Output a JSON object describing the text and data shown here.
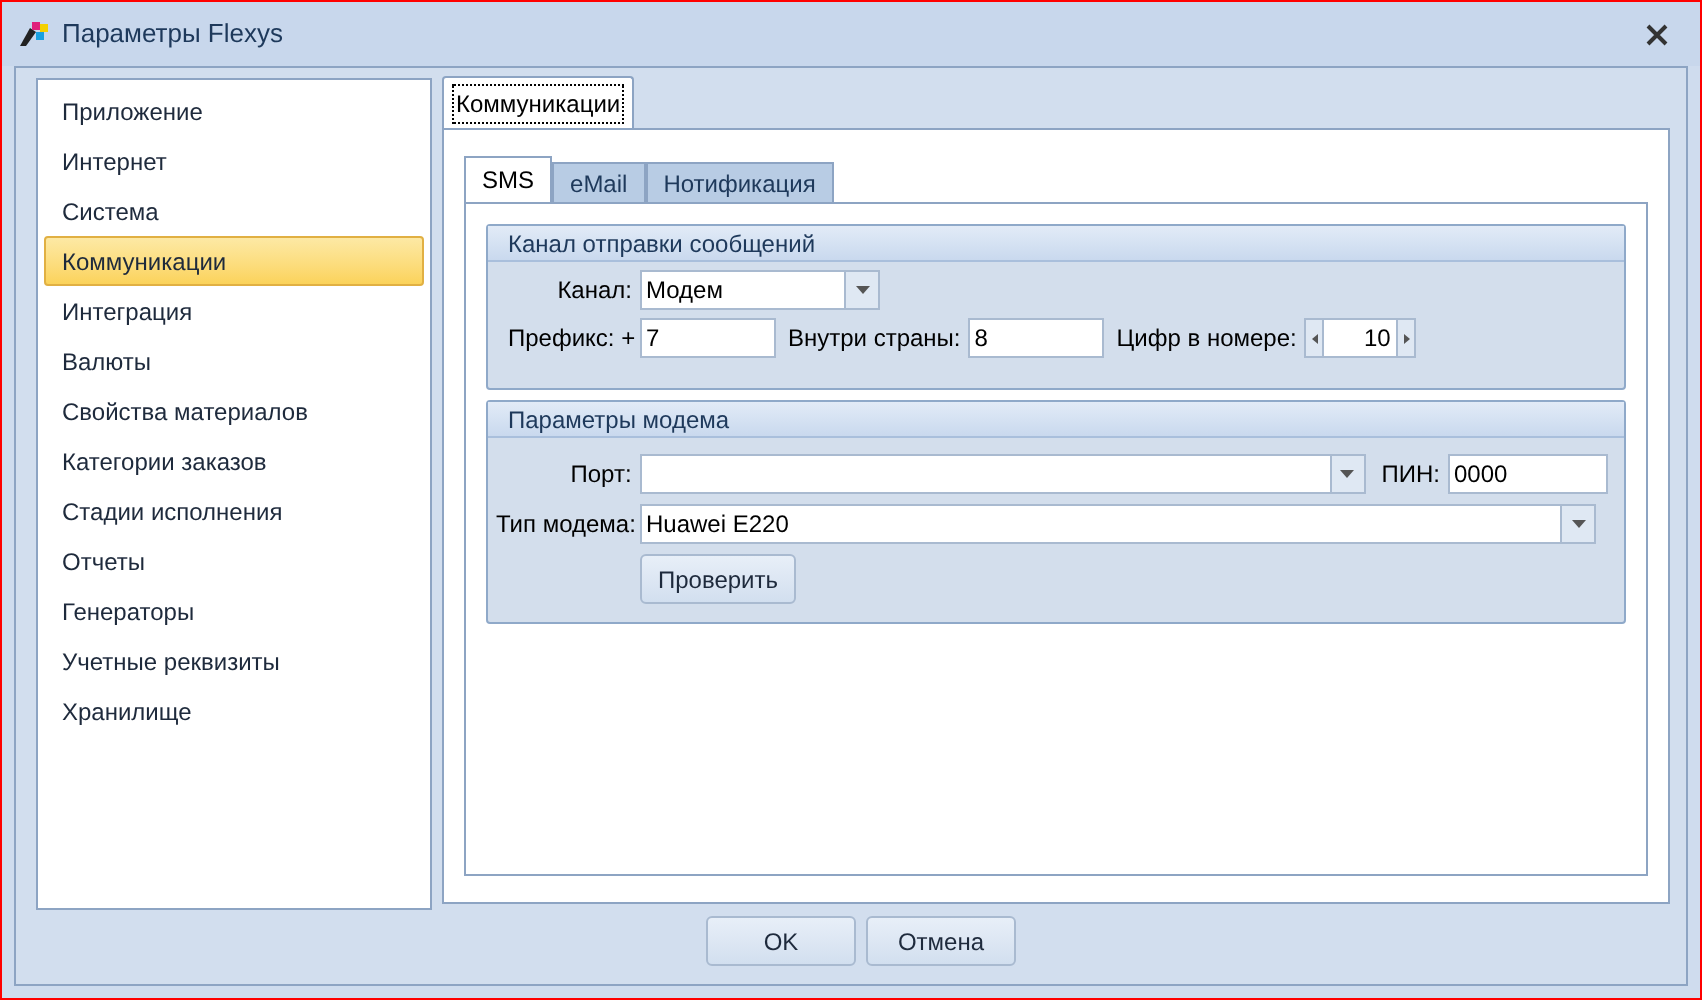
{
  "window": {
    "title": "Параметры Flexys"
  },
  "sidebar": {
    "items": [
      {
        "label": "Приложение",
        "selected": false
      },
      {
        "label": "Интернет",
        "selected": false
      },
      {
        "label": "Система",
        "selected": false
      },
      {
        "label": "Коммуникации",
        "selected": true
      },
      {
        "label": "Интеграция",
        "selected": false
      },
      {
        "label": "Валюты",
        "selected": false
      },
      {
        "label": "Свойства материалов",
        "selected": false
      },
      {
        "label": "Категории заказов",
        "selected": false
      },
      {
        "label": "Стадии исполнения",
        "selected": false
      },
      {
        "label": "Отчеты",
        "selected": false
      },
      {
        "label": "Генераторы",
        "selected": false
      },
      {
        "label": "Учетные реквизиты",
        "selected": false
      },
      {
        "label": "Хранилище",
        "selected": false
      }
    ]
  },
  "page_tab": {
    "label": "Коммуникации",
    "selected": true
  },
  "tabs": [
    {
      "label": "SMS",
      "selected": true
    },
    {
      "label": "eMail",
      "selected": false
    },
    {
      "label": "Нотификация",
      "selected": false
    }
  ],
  "channel_group": {
    "title": "Канал отправки сообщений",
    "channel_label": "Канал:",
    "channel_value": "Модем",
    "prefix_label": "Префикс: +",
    "prefix_value": "7",
    "domestic_label": "Внутри страны:",
    "domestic_value": "8",
    "digits_label": "Цифр в номере:",
    "digits_value": "10"
  },
  "modem_group": {
    "title": "Параметры модема",
    "port_label": "Порт:",
    "pin_label": "ПИН:",
    "pin_value": "0000",
    "type_label": "Тип модема:",
    "type_value": "Huawei E220",
    "check_button": "Проверить"
  },
  "buttons": [
    "OK",
    "Отмена"
  ]
}
